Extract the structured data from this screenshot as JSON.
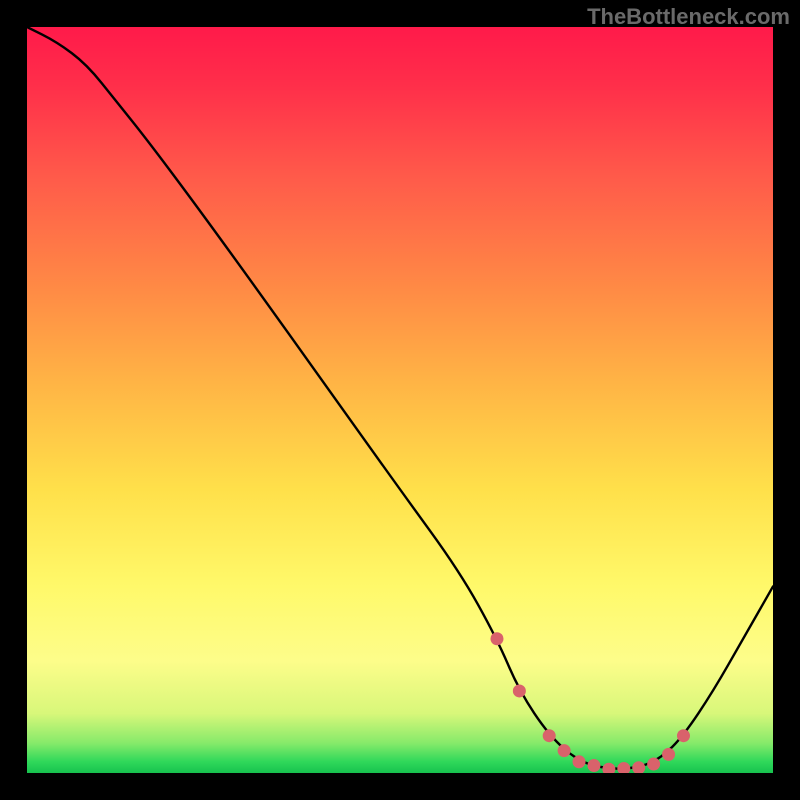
{
  "watermark": "TheBottleneck.com",
  "chart_data": {
    "type": "line",
    "title": "",
    "xlabel": "",
    "ylabel": "",
    "xlim": [
      0,
      100
    ],
    "ylim": [
      0,
      100
    ],
    "series": [
      {
        "name": "curve",
        "x": [
          0,
          4,
          8,
          12,
          16,
          22,
          30,
          40,
          50,
          58,
          63,
          66,
          70,
          74,
          78,
          82,
          85,
          88,
          92,
          96,
          100
        ],
        "values": [
          100,
          98,
          95,
          90,
          85,
          77,
          66,
          52,
          38,
          27,
          18,
          11,
          5,
          1.5,
          0.5,
          0.7,
          2,
          5,
          11,
          18,
          25
        ]
      }
    ],
    "marker_points": {
      "name": "highlight-dots",
      "color": "#d9626b",
      "x": [
        63,
        66,
        70,
        72,
        74,
        76,
        78,
        80,
        82,
        84,
        86,
        88
      ],
      "values": [
        18,
        11,
        5,
        3,
        1.5,
        1,
        0.5,
        0.6,
        0.7,
        1.2,
        2.5,
        5
      ]
    }
  }
}
